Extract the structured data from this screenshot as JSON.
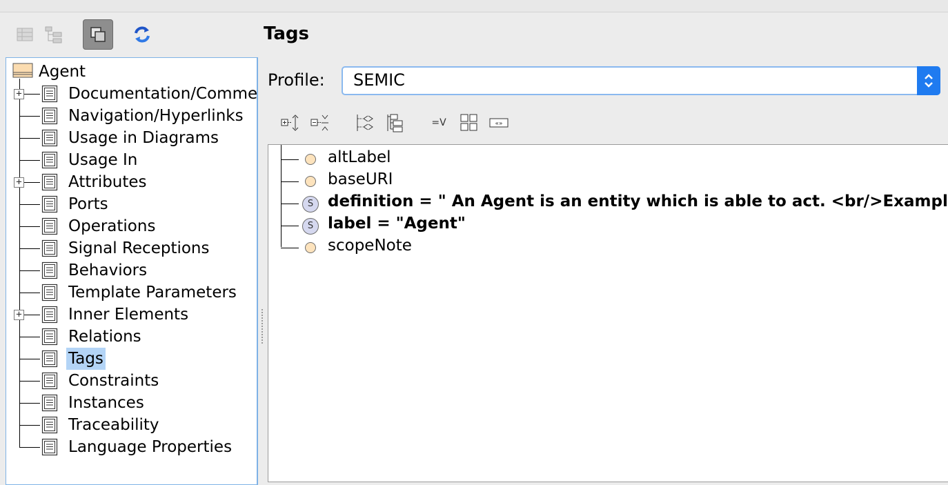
{
  "title": "Tags",
  "toolbar": {
    "buttons": [
      {
        "icon": "table-view-icon"
      },
      {
        "icon": "tree-view-icon"
      },
      {
        "icon": "copy-view-icon",
        "active": true
      },
      {
        "icon": "refresh-icon"
      }
    ]
  },
  "tree": {
    "root_label": "Agent",
    "items": [
      {
        "label": "Documentation/Comments",
        "expandable": true
      },
      {
        "label": "Navigation/Hyperlinks",
        "expandable": false
      },
      {
        "label": "Usage in Diagrams",
        "expandable": false
      },
      {
        "label": "Usage In",
        "expandable": false
      },
      {
        "label": "Attributes",
        "expandable": true
      },
      {
        "label": "Ports",
        "expandable": false
      },
      {
        "label": "Operations",
        "expandable": false
      },
      {
        "label": "Signal Receptions",
        "expandable": false
      },
      {
        "label": "Behaviors",
        "expandable": false
      },
      {
        "label": "Template Parameters",
        "expandable": false
      },
      {
        "label": "Inner Elements",
        "expandable": true
      },
      {
        "label": "Relations",
        "expandable": false
      },
      {
        "label": "Tags",
        "expandable": false,
        "selected": true
      },
      {
        "label": "Constraints",
        "expandable": false
      },
      {
        "label": "Instances",
        "expandable": false
      },
      {
        "label": "Traceability",
        "expandable": false
      },
      {
        "label": "Language Properties",
        "expandable": false
      }
    ]
  },
  "profile": {
    "label": "Profile:",
    "value": "SEMIC"
  },
  "tag_toolbar": [
    "expand-all-icon",
    "collapse-all-icon",
    "show-inherited-icon",
    "group-by-icon",
    "show-values-icon",
    "grid-view-icon",
    "stereotype-icon"
  ],
  "tag_toolbar_text": {
    "show_values": "=V",
    "stereotype": "«»"
  },
  "tags": [
    {
      "label": "altLabel",
      "kind": "dot",
      "bold": false
    },
    {
      "label": "baseURI",
      "kind": "dot",
      "bold": false
    },
    {
      "label": "definition = \" An Agent is an entity which is able to act. <br/>Examples",
      "kind": "stereotype",
      "bold": true
    },
    {
      "label": "label = \"Agent\"",
      "kind": "stereotype",
      "bold": true
    },
    {
      "label": "scopeNote",
      "kind": "dot",
      "bold": false
    }
  ],
  "stereotype_letter": "S",
  "colors": {
    "accent": "#1f7bf0",
    "selection": "#b3d4f6",
    "focus_border": "#7eb2e6",
    "tag_dot": "#fde3bd",
    "stereotype_dot": "#d5d8ef"
  }
}
